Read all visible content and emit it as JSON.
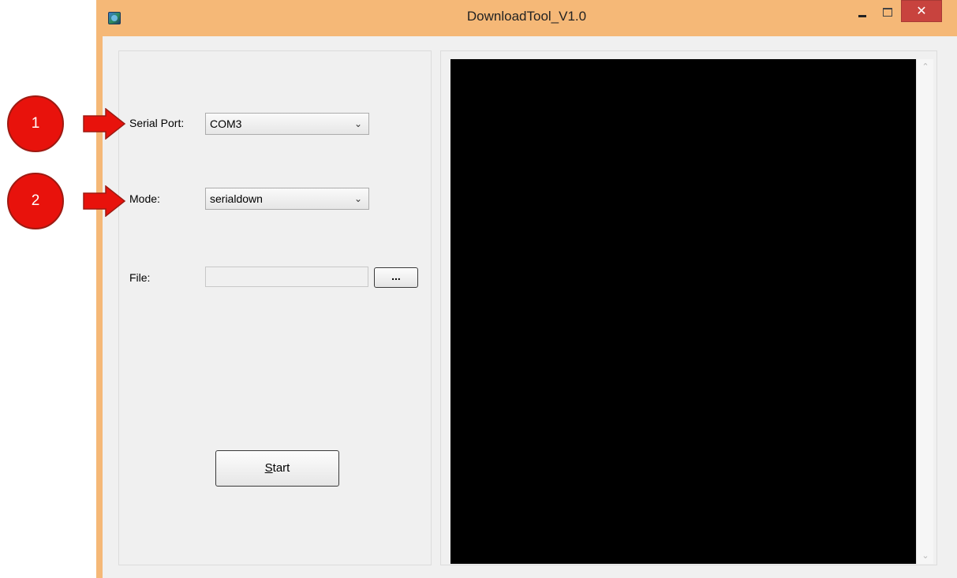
{
  "window": {
    "title": "DownloadTool_V1.0",
    "minimize_glyph": "-",
    "maximize_glyph": "□",
    "close_glyph": "✕",
    "frame_color": "#f5b877",
    "close_color": "#c8433e"
  },
  "form": {
    "serial_port_label": "Serial Port:",
    "serial_port_value": "COM3",
    "mode_label": "Mode:",
    "mode_value": "serialdown",
    "file_label": "File:",
    "file_value": "",
    "browse_label": "...",
    "start_label": "Start",
    "start_mnemonic": "S"
  },
  "log": {
    "background": "#000000"
  },
  "annotations": [
    {
      "number": "1",
      "color": "#e8120c"
    },
    {
      "number": "2",
      "color": "#e8120c"
    }
  ],
  "icons": {
    "app": "app-icon",
    "dropdown": "chevron-down-icon",
    "scroll_up": "chevron-up-icon",
    "scroll_down": "chevron-down-icon"
  }
}
